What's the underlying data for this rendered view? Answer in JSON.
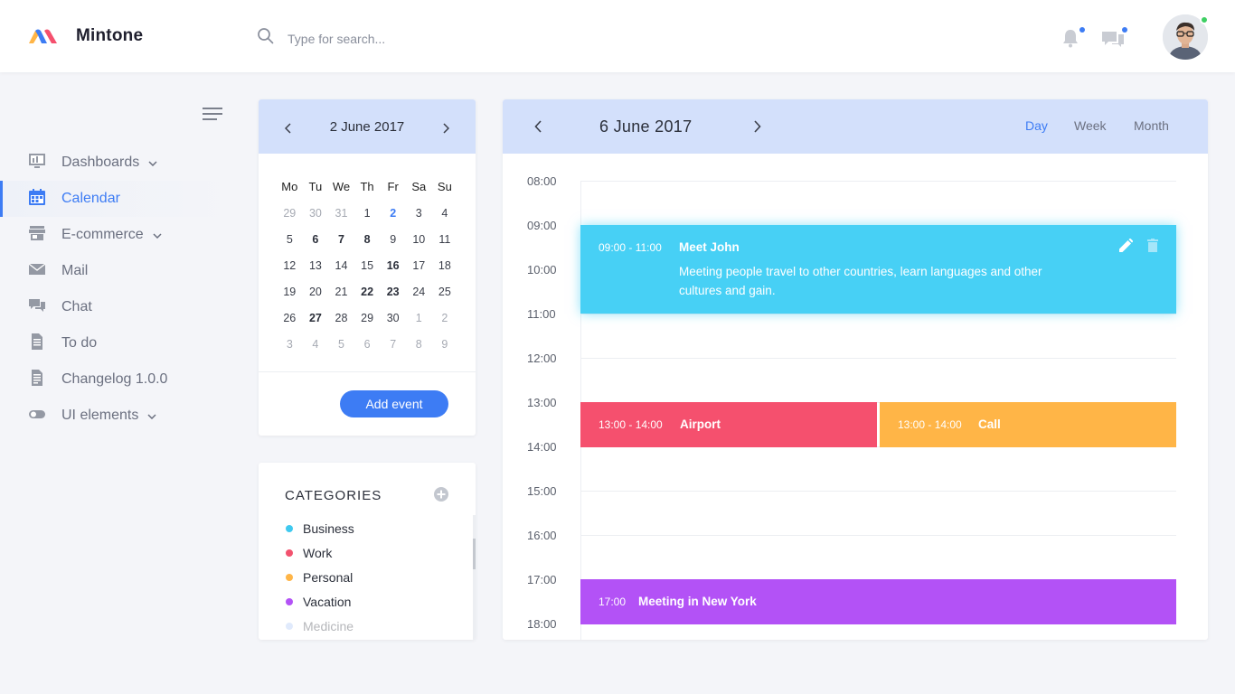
{
  "app": {
    "name": "Mintone"
  },
  "search": {
    "placeholder": "Type for search..."
  },
  "sidebar": {
    "items": [
      {
        "label": "Dashboards"
      },
      {
        "label": "Calendar"
      },
      {
        "label": "E-commerce"
      },
      {
        "label": "Mail"
      },
      {
        "label": "Chat"
      },
      {
        "label": "To do"
      },
      {
        "label": "Changelog 1.0.0"
      },
      {
        "label": "UI elements"
      }
    ]
  },
  "mini_calendar": {
    "title": "2 June 2017",
    "weekdays": [
      "Mo",
      "Tu",
      "We",
      "Th",
      "Fr",
      "Sa",
      "Su"
    ],
    "weeks": [
      [
        "29",
        "30",
        "31",
        "1",
        "2",
        "3",
        "4"
      ],
      [
        "5",
        "6",
        "7",
        "8",
        "9",
        "10",
        "11"
      ],
      [
        "12",
        "13",
        "14",
        "15",
        "16",
        "17",
        "18"
      ],
      [
        "19",
        "20",
        "21",
        "22",
        "23",
        "24",
        "25"
      ],
      [
        "26",
        "27",
        "28",
        "29",
        "30",
        "1",
        "2"
      ],
      [
        "3",
        "4",
        "5",
        "6",
        "7",
        "8",
        "9"
      ]
    ],
    "add_event_label": "Add event"
  },
  "categories": {
    "title": "CATEGORIES",
    "items": [
      {
        "label": "Business",
        "color": "#3fc9ef"
      },
      {
        "label": "Work",
        "color": "#f2526e"
      },
      {
        "label": "Personal",
        "color": "#ffb547"
      },
      {
        "label": "Vacation",
        "color": "#b352f6"
      },
      {
        "label": "Medicine",
        "color": "#a9c6f7"
      }
    ]
  },
  "calendar": {
    "title": "6 June 2017",
    "views": [
      "Day",
      "Week",
      "Month"
    ],
    "active_view": "Day",
    "hours": [
      "08:00",
      "09:00",
      "10:00",
      "11:00",
      "12:00",
      "13:00",
      "14:00",
      "15:00",
      "16:00",
      "17:00",
      "18:00"
    ],
    "events": [
      {
        "time": "09:00 - 11:00",
        "title": "Meet John",
        "description": "Meeting people travel to other countries, learn languages and other cultures and gain.",
        "color": "#47d0f5"
      },
      {
        "time": "13:00 - 14:00",
        "title": "Airport",
        "color": "#f5506e"
      },
      {
        "time": "13:00 - 14:00",
        "title": "Call",
        "color": "#ffb547"
      },
      {
        "time": "17:00",
        "title": "Meeting in New York",
        "color": "#b352f6"
      }
    ]
  },
  "colors": {
    "accent": "#3d7cf4",
    "header_bg": "#d3e0fb"
  }
}
